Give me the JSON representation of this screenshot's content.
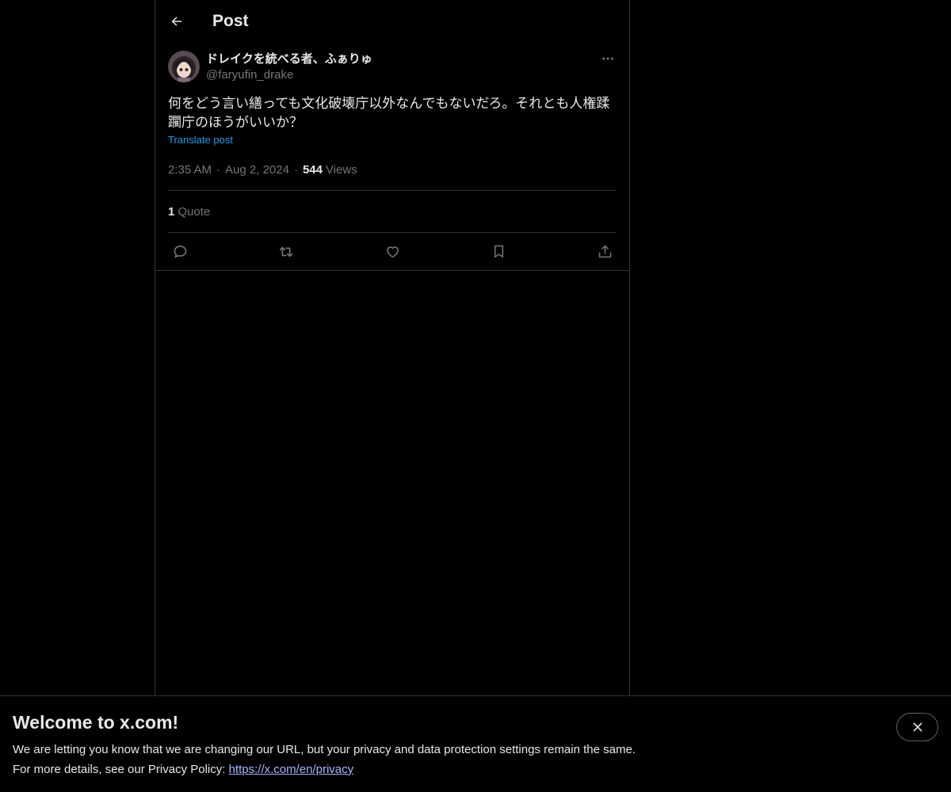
{
  "header": {
    "title": "Post",
    "back_icon": "arrow-left-icon"
  },
  "post": {
    "author": {
      "display_name": "ドレイクを統べる者、ふぁりゅ",
      "handle": "@faryufin_drake"
    },
    "text": "何をどう言い繕っても文化破壊庁以外なんでもないだろ。それとも人権蹂躙庁のほうがいいか？",
    "translate_label": "Translate post",
    "time": "2:35 AM",
    "date": "Aug 2, 2024",
    "views_count": "544",
    "views_label": "Views",
    "dot": "·",
    "quote_count": "1",
    "quote_label": "Quote"
  },
  "actions": [
    "reply-icon",
    "repost-icon",
    "like-icon",
    "bookmark-icon",
    "share-icon"
  ],
  "banner": {
    "title": "Welcome to x.com!",
    "line1": "We are letting you know that we are changing our URL, but your privacy and data protection settings remain the same.",
    "line2_prefix": "For more details, see our Privacy Policy: ",
    "link": "https://x.com/en/privacy"
  },
  "colors": {
    "background": "#000000",
    "text": "#e7e9ea",
    "muted": "#71767b",
    "accent": "#1d9bf0",
    "border": "#2f3336",
    "link": "#a9b4ff"
  }
}
